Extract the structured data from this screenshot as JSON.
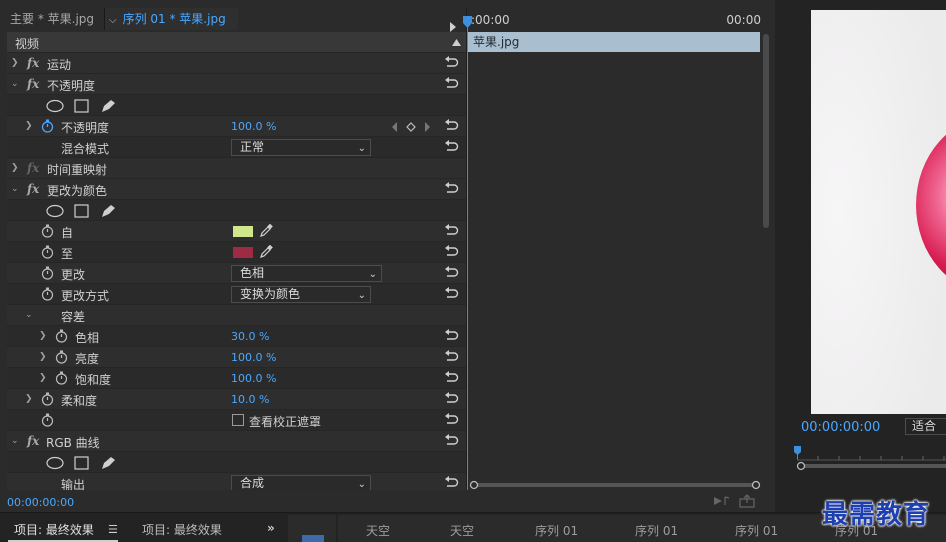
{
  "tabs": {
    "master": "主要 * 苹果.jpg",
    "sequence": "序列 01 * 苹果.jpg"
  },
  "rows": {
    "video_header": "视频",
    "motion": "运动",
    "opacity_group": "不透明度",
    "opacity_prop": "不透明度",
    "opacity_value": "100.0 %",
    "blend_mode_label": "混合模式",
    "blend_mode_value": "正常",
    "time_remap": "时间重映射",
    "change_to_color": "更改为颜色",
    "from_label": "自",
    "from_color": "#d1e78d",
    "to_label": "至",
    "to_color": "#9e2a43",
    "change_label": "更改",
    "change_value": "色相",
    "change_by_label": "更改方式",
    "change_by_value": "变换为颜色",
    "tolerance_label": "容差",
    "hue_label": "色相",
    "hue_value": "30.0 %",
    "lightness_label": "亮度",
    "lightness_value": "100.0 %",
    "saturation_label": "饱和度",
    "saturation_value": "100.0 %",
    "softness_label": "柔和度",
    "softness_value": "10.0 %",
    "view_mask_label": "查看校正遮罩",
    "rgb_curves": "RGB 曲线",
    "output_label": "输出",
    "output_value": "合成"
  },
  "ec_timecode": "00:00:00:00",
  "timeline": {
    "start": ":00:00",
    "end": "00:00",
    "clip_name": "苹果.jpg"
  },
  "program": {
    "timecode": "00:00:00:00",
    "fit": "适合"
  },
  "bottom": {
    "tab1": "项目: 最终效果",
    "tab2": "项目: 最终效果",
    "more": "»",
    "bin_items": [
      "天空",
      "天空",
      "序列 01",
      "序列 01",
      "序列 01",
      "序列 01"
    ]
  },
  "watermark": "最需教育",
  "colors": {
    "accent_blue": "#4aa8ff",
    "clip_blue": "#a9bfcf"
  }
}
